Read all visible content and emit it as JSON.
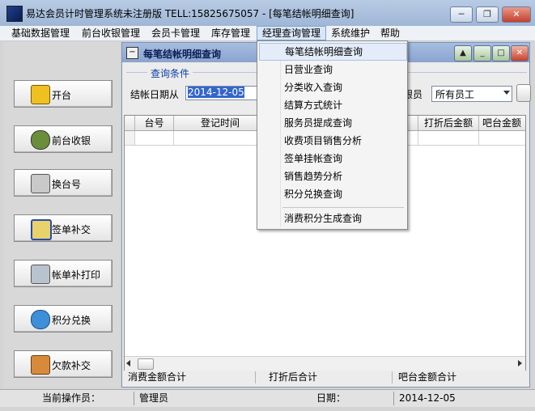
{
  "window": {
    "title": "易达会员计时管理系统未注册版 TELL:15825675057 - [每笔结帐明细查询]",
    "min": "─",
    "restore": "❐",
    "close": "✕"
  },
  "menubar": [
    {
      "label": "基础数据管理"
    },
    {
      "label": "前台收银管理"
    },
    {
      "label": "会员卡管理"
    },
    {
      "label": "库存管理"
    },
    {
      "label": "经理查询管理"
    },
    {
      "label": "系统维护"
    },
    {
      "label": "帮助"
    }
  ],
  "dropdown": {
    "items": [
      {
        "label": "每笔结帐明细查询"
      },
      {
        "label": "日营业查询"
      },
      {
        "label": "分类收入查询"
      },
      {
        "label": "结算方式统计"
      },
      {
        "label": "服务员提成查询"
      },
      {
        "label": "收费项目销售分析"
      },
      {
        "label": "签单挂帐查询"
      },
      {
        "label": "销售趋势分析"
      },
      {
        "label": "积分兑换查询"
      },
      {
        "label": "消费积分生成查询"
      }
    ]
  },
  "sidebar": {
    "buttons": [
      {
        "label": "开台",
        "icon": "open-table-icon"
      },
      {
        "label": "前台收银",
        "icon": "money-bag-icon"
      },
      {
        "label": "换台号",
        "icon": "pen-icon"
      },
      {
        "label": "签单补交",
        "icon": "sign-icon"
      },
      {
        "label": "帐单补打印",
        "icon": "printer-icon"
      },
      {
        "label": "积分兑换",
        "icon": "points-icon"
      },
      {
        "label": "欠款补交",
        "icon": "debt-icon"
      }
    ]
  },
  "child": {
    "title": "每笔结帐明细查询",
    "group_label": "查询条件",
    "date_label": "结帐日期从",
    "date_value": "2014-12-05",
    "staff_label": "银员",
    "staff_value": "所有员工",
    "columns": [
      "台号",
      "登记时间",
      "打折后金额",
      "吧台金额"
    ],
    "totals": [
      "消费金额合计",
      "打折后合计",
      "吧台金额合计"
    ]
  },
  "statusbar": {
    "operator_label": "当前操作员：",
    "operator_value": "管理员",
    "date_label": "日期：",
    "date_value": "2014-12-05"
  },
  "colors": {
    "accent": "#0b3fa8",
    "selection": "#3366cc"
  }
}
